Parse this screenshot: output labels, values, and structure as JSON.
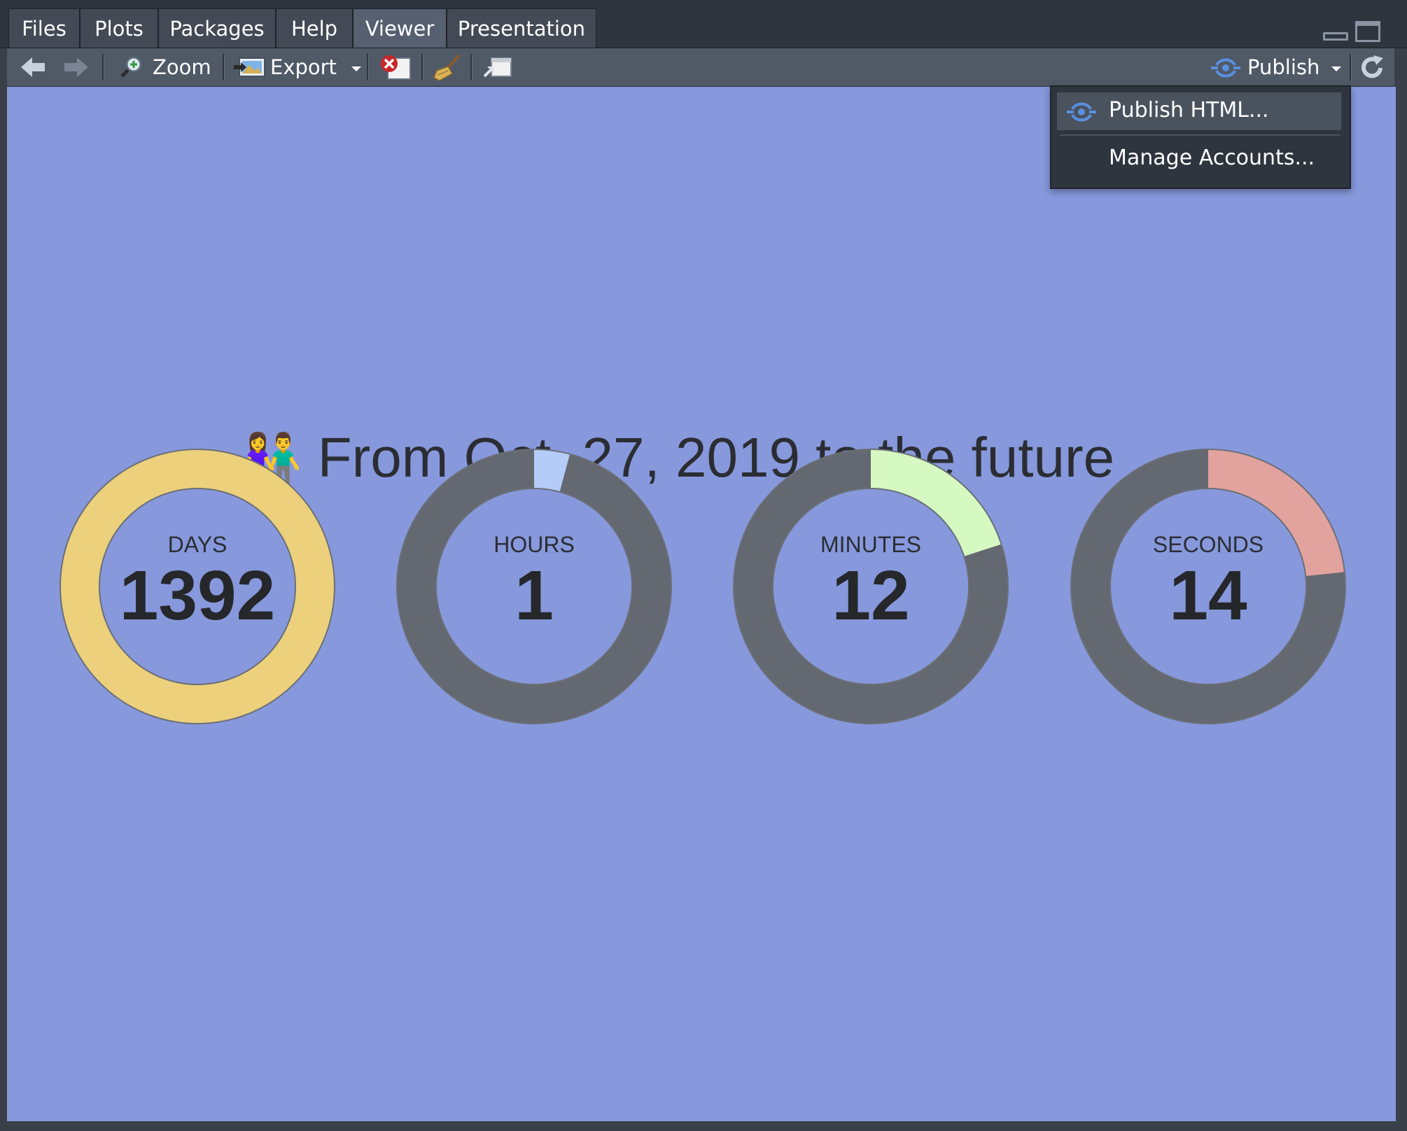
{
  "tabs": [
    {
      "label": "Files"
    },
    {
      "label": "Plots"
    },
    {
      "label": "Packages"
    },
    {
      "label": "Help"
    },
    {
      "label": "Viewer",
      "active": true
    },
    {
      "label": "Presentation"
    }
  ],
  "toolbar": {
    "zoom_label": "Zoom",
    "export_label": "Export",
    "publish_label": "Publish"
  },
  "publish_menu": {
    "items": [
      {
        "label": "Publish HTML...",
        "icon": "publish-icon",
        "highlighted": true
      },
      {
        "label": "Manage Accounts..."
      }
    ]
  },
  "page": {
    "emoji": "👫",
    "title": "From Oct. 27, 2019 to the future",
    "background": "#8799dc"
  },
  "counters": [
    {
      "label": "DAYS",
      "value": "1392",
      "fraction": 1.0,
      "color": "#ecd07b"
    },
    {
      "label": "HOURS",
      "value": "1",
      "fraction": 0.042,
      "color": "#b6ccf8"
    },
    {
      "label": "MINUTES",
      "value": "12",
      "fraction": 0.2,
      "color": "#d6f9c2"
    },
    {
      "label": "SECONDS",
      "value": "14",
      "fraction": 0.233,
      "color": "#e2a29e"
    }
  ],
  "colors": {
    "ring_track": "#646870",
    "accent": "#5a8fe0"
  }
}
